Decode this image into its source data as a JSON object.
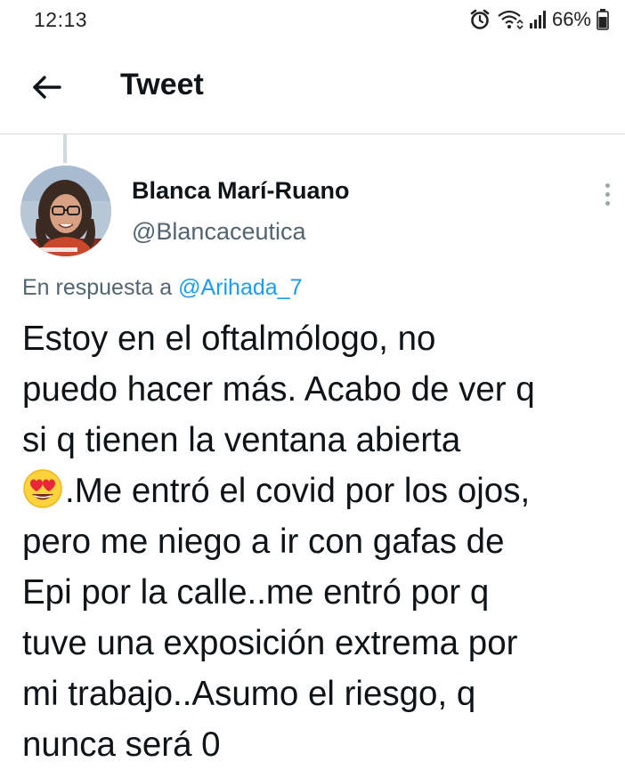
{
  "status_bar": {
    "time": "12:13",
    "battery_percent": "66%",
    "icons": [
      "alarm-icon",
      "wifi-icon",
      "signal-icon",
      "battery-icon"
    ]
  },
  "header": {
    "back_icon": "arrow-left-icon",
    "title": "Tweet"
  },
  "tweet": {
    "author": {
      "name": "Blanca Marí-Ruano",
      "handle": "@Blancaceutica",
      "avatar_icon": "avatar-photo"
    },
    "more_icon": "more-vertical-icon",
    "reply_prefix": "En respuesta a",
    "reply_to": "@Arihada_7",
    "text_lines": [
      "Estoy en el oftalmólogo, no",
      "puedo hacer más. Acabo de ver q",
      "si q tienen la ventana abierta",
      ".Me entró el covid por los ojos,",
      "pero me niego a ir con gafas de",
      "Epi por la calle..me entró por q",
      "tuve una exposición extrema por",
      "mi trabajo..Asumo el riesgo, q",
      "nunca será 0"
    ],
    "emoji": "smiling-face-with-heart-eyes-emoji"
  },
  "colors": {
    "link": "#1d9bf0",
    "secondary_text": "#536471",
    "divider": "#dcdcdc"
  }
}
